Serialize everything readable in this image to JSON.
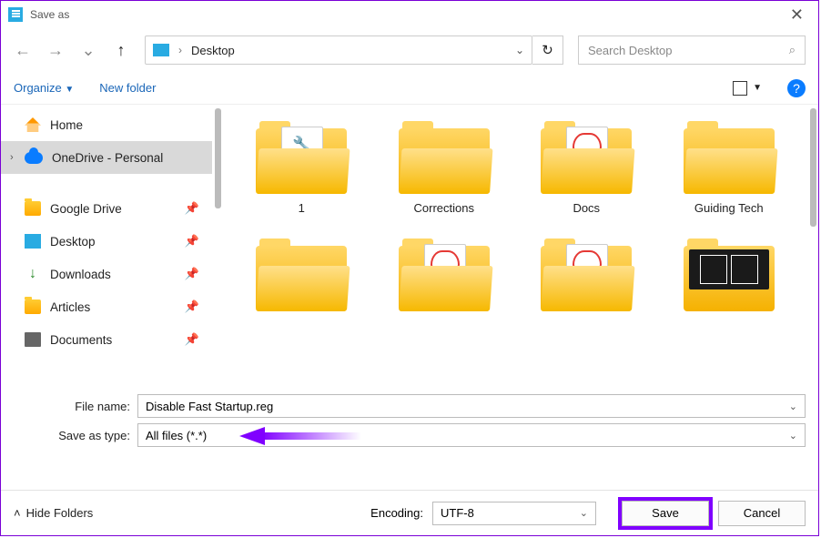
{
  "window": {
    "title": "Save as"
  },
  "breadcrumb": {
    "location": "Desktop"
  },
  "search": {
    "placeholder": "Search Desktop"
  },
  "toolbar": {
    "organize": "Organize",
    "new_folder": "New folder"
  },
  "sidebar": {
    "home": "Home",
    "onedrive": "OneDrive - Personal",
    "quick": [
      "Google Drive",
      "Desktop",
      "Downloads",
      "Articles",
      "Documents"
    ]
  },
  "tiles": [
    {
      "label": "1",
      "peek": "wrench"
    },
    {
      "label": "Corrections",
      "peek": "none"
    },
    {
      "label": "Docs",
      "peek": "pdf"
    },
    {
      "label": "Guiding Tech",
      "peek": "none"
    },
    {
      "label": "",
      "peek": "none"
    },
    {
      "label": "",
      "peek": "pdf"
    },
    {
      "label": "",
      "peek": "pdf"
    },
    {
      "label": "",
      "peek": "image"
    }
  ],
  "form": {
    "filename_label": "File name:",
    "filename_value": "Disable Fast Startup.reg",
    "type_label": "Save as type:",
    "type_value": "All files  (*.*)"
  },
  "footer": {
    "hide": "Hide Folders",
    "encoding_label": "Encoding:",
    "encoding_value": "UTF-8",
    "save": "Save",
    "cancel": "Cancel"
  }
}
